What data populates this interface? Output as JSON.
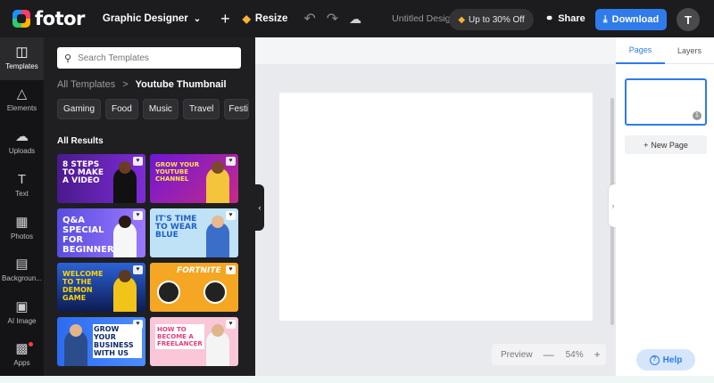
{
  "topbar": {
    "logo_text": "fotor",
    "designer_label": "Graphic Designer",
    "resize_label": "Resize",
    "document_title": "Untitled Design",
    "promo_label": "Up to 30% Off",
    "share_label": "Share",
    "download_label": "Download",
    "avatar_initial": "T"
  },
  "rail": {
    "items": [
      {
        "label": "Templates",
        "icon": "templates-icon",
        "active": true
      },
      {
        "label": "Elements",
        "icon": "elements-icon"
      },
      {
        "label": "Uploads",
        "icon": "uploads-icon"
      },
      {
        "label": "Text",
        "icon": "text-icon"
      },
      {
        "label": "Photos",
        "icon": "photos-icon"
      },
      {
        "label": "Backgroun...",
        "icon": "background-icon"
      },
      {
        "label": "AI Image",
        "icon": "ai-image-icon"
      },
      {
        "label": "Apps",
        "icon": "apps-icon"
      }
    ]
  },
  "panel": {
    "search_placeholder": "Search Templates",
    "breadcrumb_root": "All Templates",
    "breadcrumb_sep": ">",
    "breadcrumb_current": "Youtube Thumbnail",
    "chips": [
      "Gaming",
      "Food",
      "Music",
      "Travel",
      "Festi"
    ],
    "results_heading": "All Results",
    "thumbnails": [
      {
        "text": "8 STEPS TO MAKE A VIDEO"
      },
      {
        "text": "GROW YOUR YOUTUBE CHANNEL"
      },
      {
        "text": "Q&A SPECIAL FOR BEGINNER"
      },
      {
        "text": "IT'S TIME TO WEAR BLUE"
      },
      {
        "text": "WELCOME TO THE DEMON GAME"
      },
      {
        "text": "FORTNITE"
      },
      {
        "text": "GROW YOUR BUSINESS WITH US"
      },
      {
        "text": "HOW TO BECOME A FREELANCER"
      }
    ]
  },
  "workspace": {
    "preview_label": "Preview",
    "zoom_minus": "—",
    "zoom_value": "54%",
    "zoom_plus": "+"
  },
  "right_panel": {
    "tab_pages": "Pages",
    "tab_layers": "Layers",
    "page_number": "1",
    "new_page_label": "New Page"
  },
  "help_label": "Help",
  "colors": {
    "accent": "#2f7bea",
    "topbar": "#1c1c1e",
    "panel": "#1f1f22"
  }
}
